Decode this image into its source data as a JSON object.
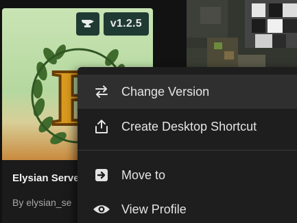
{
  "card": {
    "version_badge": "v1.2.5",
    "loader_icon": "anvil-icon",
    "logo_letter": "E",
    "title": "Elysian Serve",
    "author": "By elysian_se"
  },
  "context_menu": {
    "items": [
      {
        "label": "Change Version",
        "icon": "swap-arrows-icon"
      },
      {
        "label": "Create Desktop Shortcut",
        "icon": "share-box-icon"
      },
      {
        "label": "Move to",
        "icon": "arrow-box-icon"
      },
      {
        "label": "View Profile",
        "icon": "eye-icon"
      }
    ]
  },
  "colors": {
    "menu_bg": "#1e1e1e",
    "menu_hover": "#2f2f2f",
    "badge_bg": "#1f3a33",
    "logo_gold": "#d99a1e"
  }
}
